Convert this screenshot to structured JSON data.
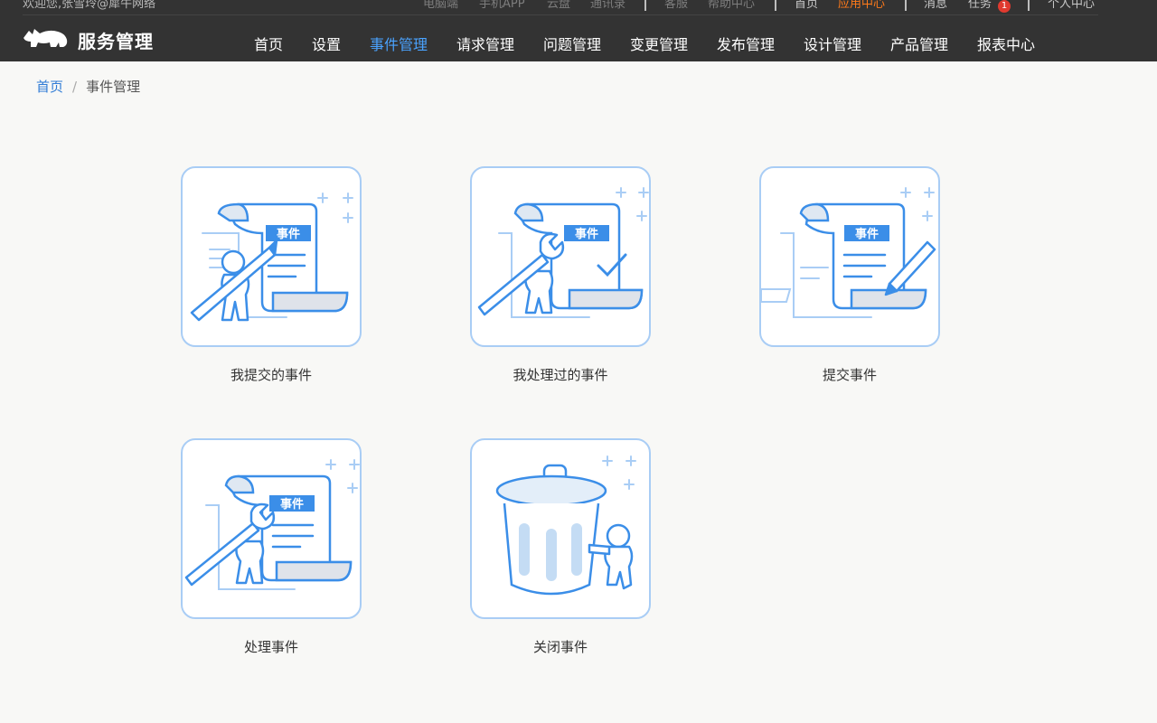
{
  "topbar": {
    "welcome": "欢迎您,张雪玲@犀牛网络",
    "links": [
      "电脑端",
      "手机APP",
      "云盘",
      "通讯录",
      "客服",
      "帮助中心"
    ],
    "home": "首页",
    "app_center": "应用中心",
    "messages": "消息",
    "tasks": "任务",
    "task_count": "1",
    "profile": "个人中心"
  },
  "logo": {
    "text": "服务管理"
  },
  "nav": {
    "items": [
      "首页",
      "设置",
      "事件管理",
      "请求管理",
      "问题管理",
      "变更管理",
      "发布管理",
      "设计管理",
      "产品管理",
      "报表中心"
    ],
    "active": "事件管理"
  },
  "breadcrumb": {
    "home": "首页",
    "separator": "/",
    "current": "事件管理"
  },
  "cards": [
    {
      "label": "我提交的事件",
      "badge": "事件",
      "icon": "document-pencil-person-icon"
    },
    {
      "label": "我处理过的事件",
      "badge": "事件",
      "icon": "document-wrench-check-icon"
    },
    {
      "label": "提交事件",
      "badge": "事件",
      "icon": "document-pencil-icon"
    },
    {
      "label": "处理事件",
      "badge": "事件",
      "icon": "document-wrench-person-icon"
    },
    {
      "label": "关闭事件",
      "icon": "trash-can-person-icon"
    }
  ],
  "colors": {
    "header_bg": "#333333",
    "accent": "#4aa3ff",
    "link": "#2f7bd6",
    "orange": "#ff7a1a",
    "card_border": "#a9cdf5",
    "illustration_blue": "#3b8ee8"
  }
}
